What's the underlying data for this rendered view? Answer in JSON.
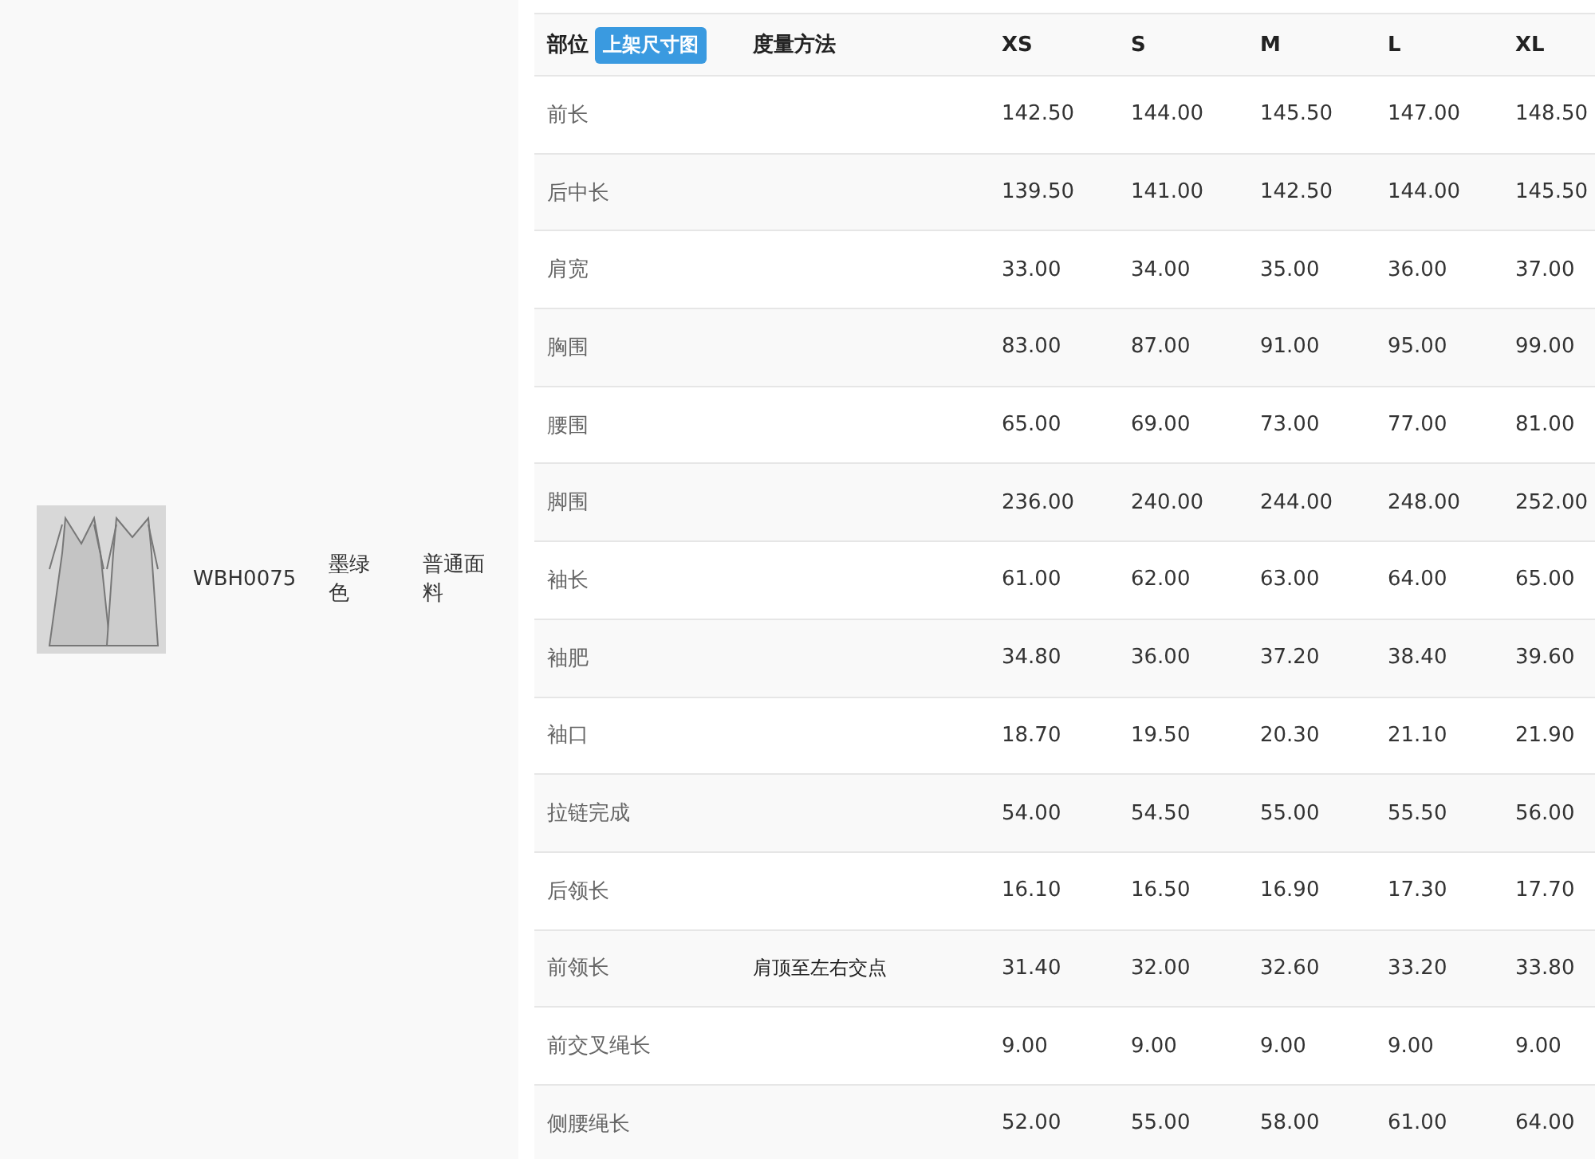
{
  "product": {
    "code": "WBH0075",
    "color_name": "墨绿色",
    "fabric": "普通面料"
  },
  "table": {
    "part_header": "部位",
    "badge": "上架尺寸图",
    "method_header": "度量方法",
    "sizes": [
      "XS",
      "S",
      "M",
      "L",
      "XL"
    ],
    "rows": [
      {
        "part": "前长",
        "method": "",
        "values": [
          "142.50",
          "144.00",
          "145.50",
          "147.00",
          "148.50"
        ]
      },
      {
        "part": "后中长",
        "method": "",
        "values": [
          "139.50",
          "141.00",
          "142.50",
          "144.00",
          "145.50"
        ]
      },
      {
        "part": "肩宽",
        "method": "",
        "values": [
          "33.00",
          "34.00",
          "35.00",
          "36.00",
          "37.00"
        ]
      },
      {
        "part": "胸围",
        "method": "",
        "values": [
          "83.00",
          "87.00",
          "91.00",
          "95.00",
          "99.00"
        ]
      },
      {
        "part": "腰围",
        "method": "",
        "values": [
          "65.00",
          "69.00",
          "73.00",
          "77.00",
          "81.00"
        ]
      },
      {
        "part": "脚围",
        "method": "",
        "values": [
          "236.00",
          "240.00",
          "244.00",
          "248.00",
          "252.00"
        ]
      },
      {
        "part": "袖长",
        "method": "",
        "values": [
          "61.00",
          "62.00",
          "63.00",
          "64.00",
          "65.00"
        ]
      },
      {
        "part": "袖肥",
        "method": "",
        "values": [
          "34.80",
          "36.00",
          "37.20",
          "38.40",
          "39.60"
        ]
      },
      {
        "part": "袖口",
        "method": "",
        "values": [
          "18.70",
          "19.50",
          "20.30",
          "21.10",
          "21.90"
        ]
      },
      {
        "part": "拉链完成",
        "method": "",
        "values": [
          "54.00",
          "54.50",
          "55.00",
          "55.50",
          "56.00"
        ]
      },
      {
        "part": "后领长",
        "method": "",
        "values": [
          "16.10",
          "16.50",
          "16.90",
          "17.30",
          "17.70"
        ]
      },
      {
        "part": "前领长",
        "method": "肩顶至左右交点",
        "values": [
          "31.40",
          "32.00",
          "32.60",
          "33.20",
          "33.80"
        ]
      },
      {
        "part": "前交叉绳长",
        "method": "",
        "values": [
          "9.00",
          "9.00",
          "9.00",
          "9.00",
          "9.00"
        ]
      },
      {
        "part": "侧腰绳长",
        "method": "",
        "values": [
          "52.00",
          "55.00",
          "58.00",
          "61.00",
          "64.00"
        ]
      }
    ]
  }
}
